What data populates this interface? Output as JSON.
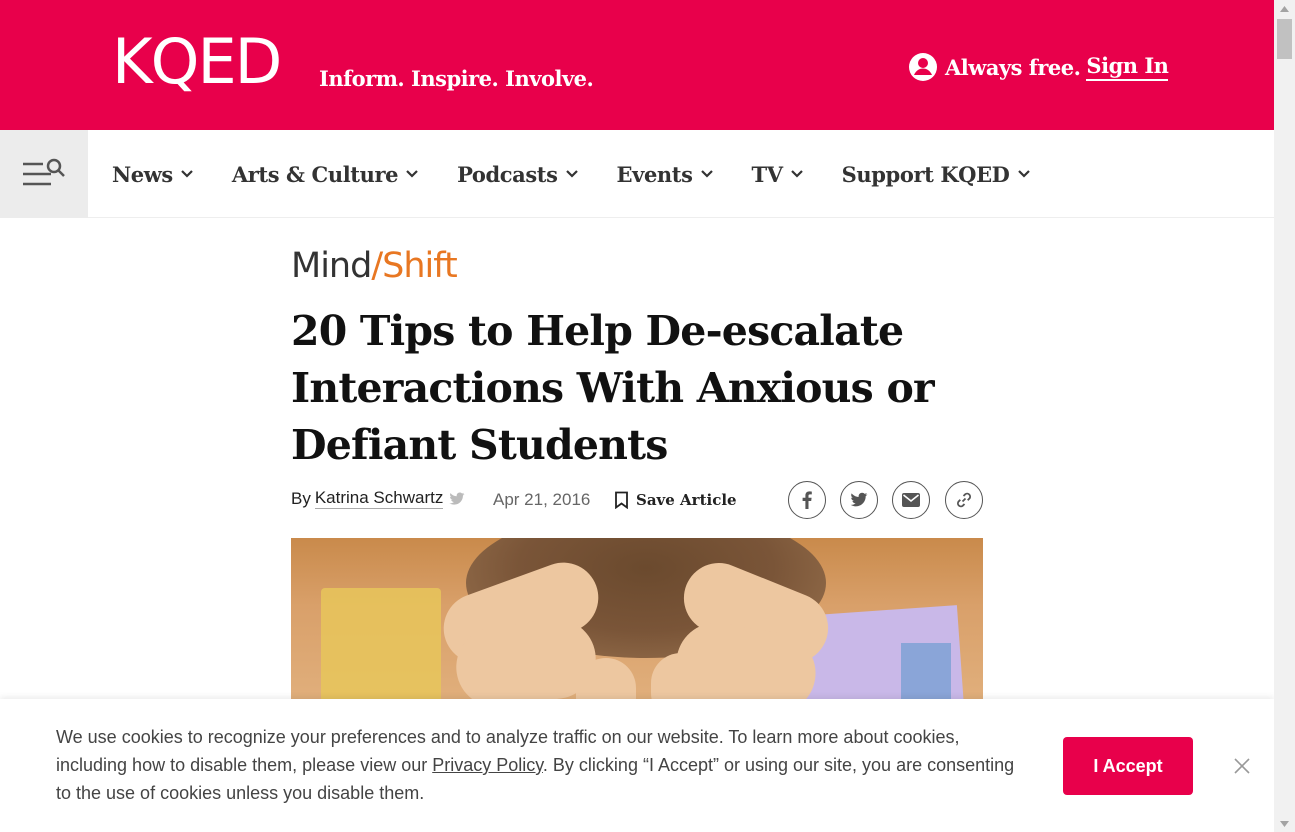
{
  "header": {
    "logo": "KQED",
    "tagline": "Inform. Inspire. Involve.",
    "always_free": "Always free.",
    "sign_in": "Sign In",
    "brand_color": "#e8004b"
  },
  "nav": {
    "menu_icon": "menu-search-icon",
    "items": [
      {
        "label": "News"
      },
      {
        "label": "Arts & Culture"
      },
      {
        "label": "Podcasts"
      },
      {
        "label": "Events"
      },
      {
        "label": "TV"
      },
      {
        "label": "Support KQED"
      }
    ]
  },
  "article": {
    "section_logo": {
      "part1": "Mind",
      "slash": "/",
      "part2": "Shift"
    },
    "title": "20 Tips to Help De-escalate Interactions With Anxious or Defiant Students",
    "by_prefix": "By",
    "author": "Katrina Schwartz",
    "date": "Apr 21, 2016",
    "save_label": "Save Article",
    "share_icons": [
      "facebook-icon",
      "twitter-icon",
      "email-icon",
      "link-icon"
    ]
  },
  "cookie_banner": {
    "text_before_link": "We use cookies to recognize your preferences and to analyze traffic on our website. To learn more about cookies, including how to disable them, please view our ",
    "link_text": "Privacy Policy",
    "text_after_link": ". By clicking “I Accept” or using our site, you are consenting to the use of cookies unless you disable them.",
    "accept_label": "I Accept"
  }
}
